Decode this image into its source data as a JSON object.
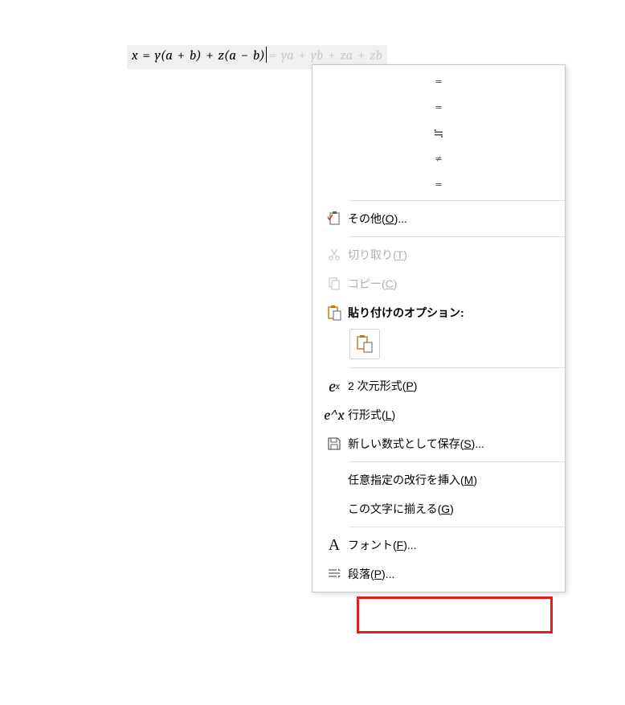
{
  "equation": {
    "visible": "x = y(a + b) + z(a − b)",
    "obscured": "= ya + yb + za + zb"
  },
  "autocorrect": [
    "=",
    "=",
    "≒",
    "≠",
    "="
  ],
  "menu": {
    "other": {
      "text": "その他",
      "key": "O",
      "suffix": "..."
    },
    "cut": {
      "text": "切り取り",
      "key": "T"
    },
    "copy": {
      "text": "コピー",
      "key": "C"
    },
    "pasteHeader": {
      "text": "貼り付けのオプション:"
    },
    "prof": {
      "text": "2 次元形式",
      "key": "P"
    },
    "linear": {
      "text": "行形式",
      "key": "L"
    },
    "saveNew": {
      "text": "新しい数式として保存",
      "key": "S",
      "suffix": "..."
    },
    "manualBreak": {
      "text": "任意指定の改行を挿入",
      "key": "M"
    },
    "alignAt": {
      "text": "この文字に揃える",
      "key": "G"
    },
    "font": {
      "text": "フォント",
      "key": "F",
      "suffix": "..."
    },
    "paragraph": {
      "text": "段落",
      "key": "P",
      "suffix": "..."
    }
  }
}
